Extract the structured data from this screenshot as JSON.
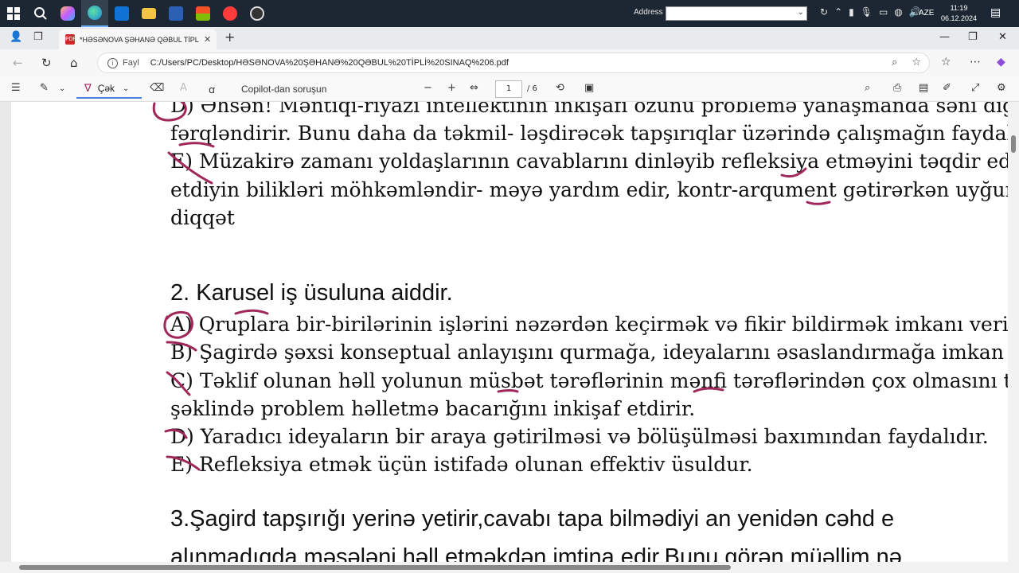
{
  "taskbar": {
    "address_label": "Address",
    "language": "AZE",
    "time": "11:19",
    "date": "06.12.2024",
    "notification_count": "7"
  },
  "browser": {
    "tab_title": "*HƏSƏNOVA ŞƏHANƏ QƏBUL TİPLİ SINAQ 6.pdf",
    "scheme_label": "Fayl",
    "url": "C:/Users/PC/Desktop/HƏSƏNOVA%20ŞƏHANƏ%20QƏBUL%20TİPLİ%20SINAQ%206.pdf"
  },
  "pdf_toolbar": {
    "draw_label": "Çək",
    "copilot_label": "Copilot-dan soruşun",
    "page_current": "1",
    "page_total": "/ 6"
  },
  "document": {
    "lines": [
      "D) Əhsən! Məntiqi-riyazi intellektinin inkişafı özünü problemə yanaşmanda səni digə",
      "fərqləndirir. Bunu daha da təkmil- ləşdirəcək tapşırıqlar üzərində çalışmağın faydalı o",
      "E) Müzakirə zamanı yoldaşlarının cavablarını dinləyib refleksiya etməyini təqdir edira",
      "etdiyin bilikləri möhkəmləndir- məyə yardım edir, kontr-arqument gətirərkən uyğun z",
      "diqqət",
      "2. Karusel iş üsuluna aiddir.",
      "A) Qruplara bir-birilərinin işlərini nəzərdən keçirmək və fikir bildirmək imkanı verir.",
      "B) Şagirdə şəxsi konseptual anlayışını qurmağa, ideyalarını əsaslandırmağa imkan ver",
      "C) Təklif olunan həll yolunun müsbət tərəflərinin mənfi tərəflərindən çox olmasını təl",
      "şəklində problem həlletmə bacarığını inkişaf etdirir.",
      "D) Yaradıcı ideyaların bir araya gətirilməsi və bölüşülməsi baxımından faydalıdır.",
      "E) Refleksiya etmək üçün istifadə olunan effektiv üsuldur.",
      "3.Şagird tapşırığı yerinə yetirir,cavabı tapa bilmədiyi an  yenidən cəhd e",
      "alınmadıqda məsələni həll etməkdən imtina edir.Bunu görən müəllim nə"
    ]
  },
  "colors": {
    "taskbar_bg": "#1c2733",
    "ink": "#a0275a",
    "accent": "#4a7fd6"
  }
}
